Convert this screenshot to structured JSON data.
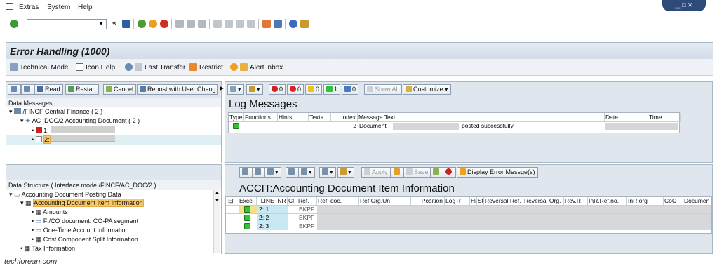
{
  "menu": {
    "items": [
      "Extras",
      "System",
      "Help"
    ]
  },
  "title": "Error Handling (1000)",
  "app_toolbar": {
    "items": [
      "Technical Mode",
      "Icon Help",
      "Last Transfer",
      "Restrict",
      "Alert inbox"
    ]
  },
  "left_top": {
    "buttons": [
      "Read",
      "Restart",
      "Cancel",
      "Repost with User Chang"
    ],
    "header": "Data Messages",
    "tree": [
      "/FINCF Central Finance ( 2 )",
      "AC_DOC/2 Accounting Document ( 2 )",
      "1:",
      "2:"
    ]
  },
  "right_top": {
    "counts": [
      "0",
      "0",
      "0",
      "1",
      "0"
    ],
    "show_all": "Show All",
    "customize": "Customize",
    "title": "Log Messages",
    "columns": [
      "Type",
      "Functions",
      "Hints",
      "Texts",
      "Index",
      "Message Text",
      "Date",
      "Time"
    ],
    "row": {
      "index": "2",
      "text1": "Document",
      "text2": "posted successfully"
    }
  },
  "left_bottom": {
    "header": "Data Structure ( Interface mode /FINCF/AC_DOC/2 )",
    "tree": [
      "Accounting Document Posting Data",
      "Accounting Document Item Information",
      "Amounts",
      "FI/CO document: CO-PA segment",
      "One-Time Account Information",
      "Cost Component Split Information",
      "Tax Information"
    ]
  },
  "right_bottom": {
    "buttons": {
      "apply": "Apply",
      "save": "Save",
      "display_error": "Display Error Messge(s)"
    },
    "title": "ACCIT:Accounting Document Item Information",
    "columns": [
      "Exce_",
      "_LINE_NR",
      "Cl_",
      "Ref._",
      "Ref. doc.",
      "Ref.Org.Un",
      "Position",
      "LogTr",
      "Hi",
      "St",
      "Reversal Ref.",
      "Reversal Org.",
      "Rev.R_",
      "InR.Ref.no.",
      "InR.org",
      "CoC_",
      "Documen"
    ],
    "rows": [
      {
        "line": "2: 1",
        "ref": "BKPF"
      },
      {
        "line": "2: 2",
        "ref": "BKPF"
      },
      {
        "line": "2: 3",
        "ref": "BKPF"
      }
    ]
  },
  "footer": "techlorean.com",
  "colors": {
    "accent": "#2d4a78",
    "selected": "#f7c96b",
    "status_green": "#35c135"
  }
}
